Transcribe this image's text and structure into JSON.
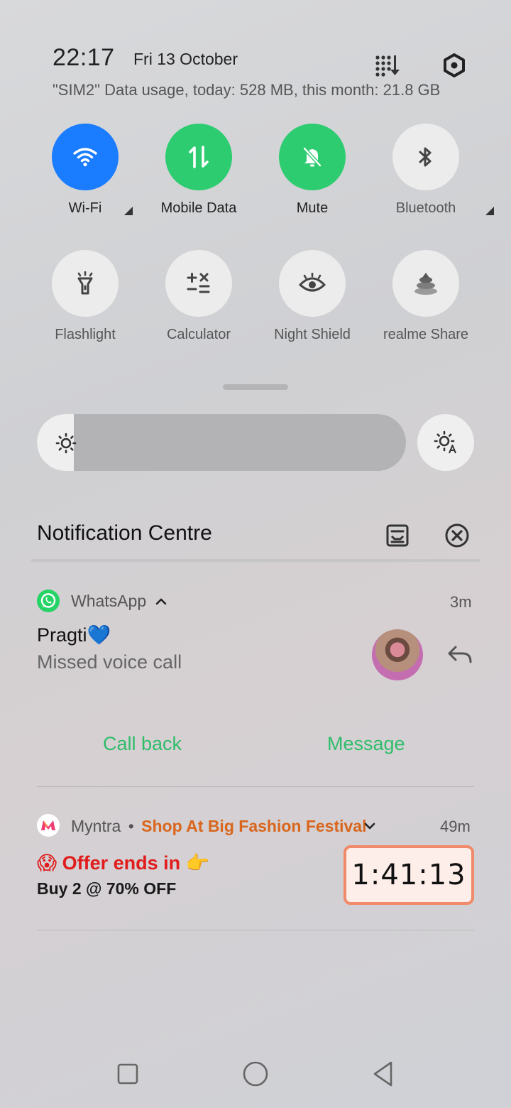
{
  "header": {
    "time": "22:17",
    "date": "Fri 13 October",
    "usage": "\"SIM2\" Data usage, today: 528 MB, this month: 21.8 GB"
  },
  "tiles": [
    {
      "label": "Wi-Fi",
      "icon": "wifi-icon",
      "active": true,
      "color": "#1a7cff"
    },
    {
      "label": "Mobile Data",
      "icon": "mobile-data-icon",
      "active": true,
      "color": "#2ecc71"
    },
    {
      "label": "Mute",
      "icon": "mute-bell-icon",
      "active": true,
      "color": "#2ecc71"
    },
    {
      "label": "Bluetooth",
      "icon": "bluetooth-icon",
      "active": false
    },
    {
      "label": "Flashlight",
      "icon": "flashlight-icon",
      "active": false
    },
    {
      "label": "Calculator",
      "icon": "calculator-icon",
      "active": false
    },
    {
      "label": "Night Shield",
      "icon": "eye-icon",
      "active": false
    },
    {
      "label": "realme Share",
      "icon": "realme-share-icon",
      "active": false
    }
  ],
  "brightness": {
    "level": 0.1
  },
  "notification_centre": {
    "title": "Notification Centre"
  },
  "whatsapp": {
    "app": "WhatsApp",
    "time": "3m",
    "name": "Pragti💙",
    "message": "Missed voice call",
    "call_back": "Call back",
    "message_action": "Message"
  },
  "myntra": {
    "app": "Myntra",
    "dot": "•",
    "promo": "Shop At Big Fashion Festival",
    "time": "49m",
    "offer": "😱 Offer ends in 👉",
    "deal": "Buy 2 @ 70% OFF",
    "timer": "1:41:13"
  }
}
